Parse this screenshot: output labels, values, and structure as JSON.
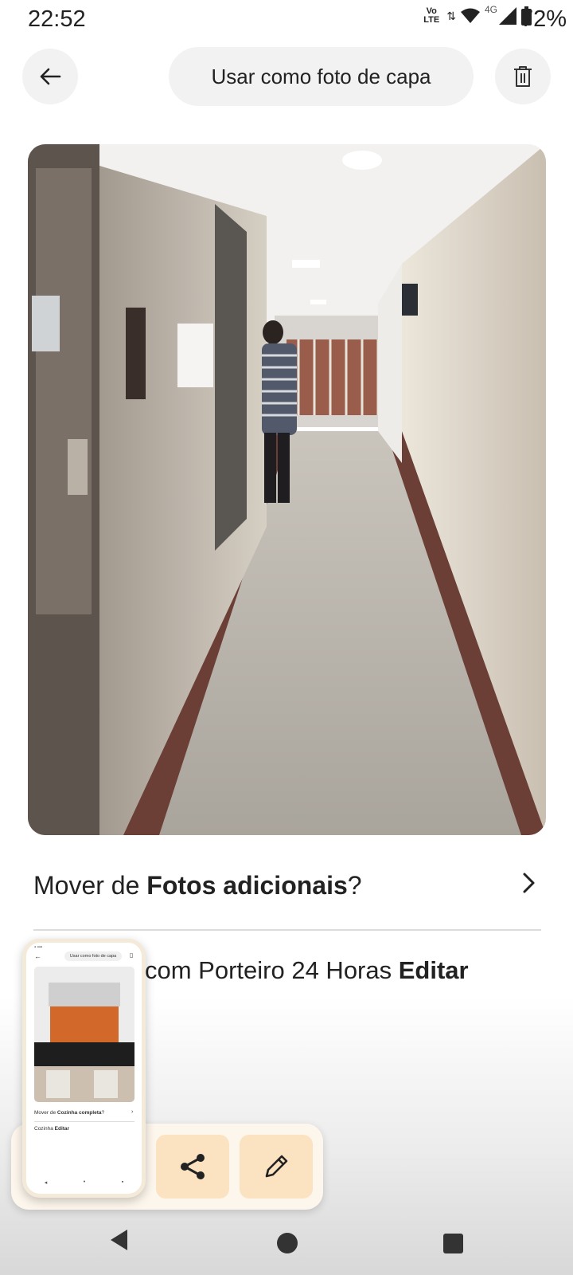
{
  "status_bar": {
    "time": "22:52",
    "volte": "Vo LTE",
    "network": "4G",
    "battery": "72%"
  },
  "header": {
    "back_icon": "arrow-left-icon",
    "cover_label": "Usar como foto de capa",
    "delete_icon": "trash-icon"
  },
  "photo": {
    "description_icon": "hallway-photo"
  },
  "move": {
    "prefix": "Mover de ",
    "section": "Fotos adicionais",
    "suffix": "?",
    "chevron_icon": "chevron-right-icon"
  },
  "caption": {
    "text": "com Porteiro 24 Horas ",
    "edit_label": "Editar"
  },
  "toolbar": {
    "share_icon": "share-icon",
    "edit_icon": "pencil-icon"
  },
  "preview": {
    "cover_label": "Usar como foto de capa",
    "move_prefix": "Mover de ",
    "move_section": "Cozinha completa",
    "move_suffix": "?",
    "caption": "Cozinha ",
    "edit_label": "Editar"
  },
  "nav": {
    "back_icon": "triangle-back-icon",
    "home_icon": "circle-home-icon",
    "recent_icon": "square-recents-icon"
  },
  "colors": {
    "accent_button": "#fbe3c1",
    "toolbar_bg": "#fdf6ec",
    "chip_bg": "#f2f2f2"
  }
}
